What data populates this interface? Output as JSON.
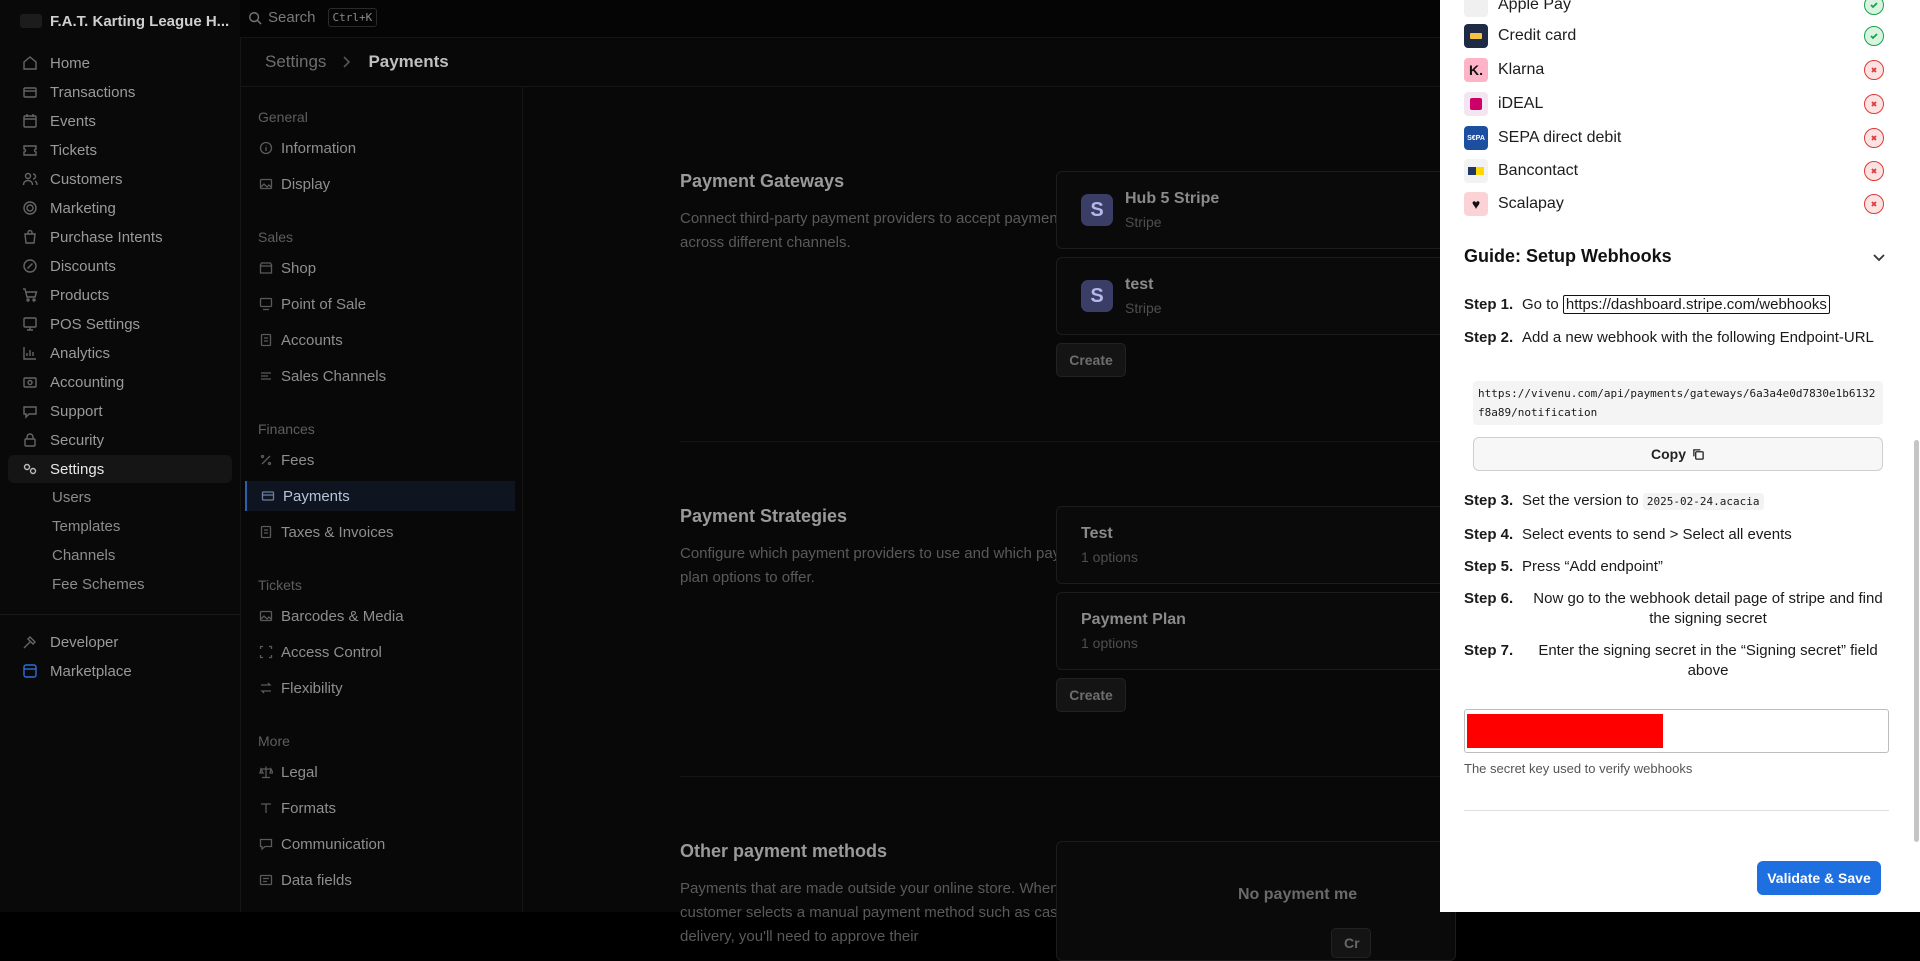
{
  "app": {
    "brand": "F.A.T. Karting League H...",
    "search_label": "Search",
    "search_shortcut": "Ctrl+K"
  },
  "nav": {
    "items": [
      {
        "label": "Home",
        "icon": "home-icon"
      },
      {
        "label": "Transactions",
        "icon": "transactions-icon"
      },
      {
        "label": "Events",
        "icon": "calendar-icon"
      },
      {
        "label": "Tickets",
        "icon": "ticket-icon"
      },
      {
        "label": "Customers",
        "icon": "users-icon"
      },
      {
        "label": "Marketing",
        "icon": "target-icon"
      },
      {
        "label": "Purchase Intents",
        "icon": "bag-icon"
      },
      {
        "label": "Discounts",
        "icon": "discount-icon"
      },
      {
        "label": "Products",
        "icon": "cart-icon"
      },
      {
        "label": "POS Settings",
        "icon": "pos-icon"
      },
      {
        "label": "Analytics",
        "icon": "chart-icon"
      },
      {
        "label": "Accounting",
        "icon": "accounting-icon"
      },
      {
        "label": "Support",
        "icon": "support-icon"
      },
      {
        "label": "Security",
        "icon": "lock-icon"
      },
      {
        "label": "Settings",
        "icon": "settings-icon"
      }
    ],
    "settings_sub": [
      "Users",
      "Templates",
      "Channels",
      "Fee Schemes"
    ],
    "developer": "Developer",
    "marketplace": "Marketplace"
  },
  "breadcrumb": {
    "parent": "Settings",
    "current": "Payments"
  },
  "subnav": {
    "general": "General",
    "information": "Information",
    "display": "Display",
    "sales": "Sales",
    "shop": "Shop",
    "pos": "Point of Sale",
    "accounts": "Accounts",
    "sales_channels": "Sales Channels",
    "finances": "Finances",
    "fees": "Fees",
    "payments": "Payments",
    "taxes": "Taxes & Invoices",
    "tickets": "Tickets",
    "barcodes": "Barcodes & Media",
    "access": "Access Control",
    "flexibility": "Flexibility",
    "more": "More",
    "legal": "Legal",
    "formats": "Formats",
    "communication": "Communication",
    "data_fields": "Data fields"
  },
  "gateways": {
    "title": "Payment Gateways",
    "desc": "Connect third-party payment providers to accept payments across different channels.",
    "items": [
      {
        "badge": "S",
        "name": "Hub 5 Stripe",
        "provider": "Stripe"
      },
      {
        "badge": "S",
        "name": "test",
        "provider": "Stripe"
      }
    ],
    "create": "Create"
  },
  "strategies": {
    "title": "Payment Strategies",
    "desc": "Configure which payment providers to use and which payment plan options to offer.",
    "items": [
      {
        "name": "Test",
        "sub": "1 options"
      },
      {
        "name": "Payment Plan",
        "sub": "1 options"
      }
    ],
    "create": "Create"
  },
  "other": {
    "title": "Other payment methods",
    "desc": "Payments that are made outside your online store. When a customer selects a manual payment method such as cash on delivery, you'll need to approve their",
    "empty": "No payment me",
    "create_partial": "Cr"
  },
  "drawer": {
    "methods": [
      {
        "name": "Apple Pay",
        "status": "enabled",
        "logo_bg": "#f0f0f0",
        "logo_color": "#111",
        "logo_text": ""
      },
      {
        "name": "Credit card",
        "status": "enabled",
        "logo_bg": "#1f2a44",
        "logo_color": "#f5c242",
        "logo_text": ""
      },
      {
        "name": "Klarna",
        "status": "disabled",
        "logo_bg": "#ffb3c7",
        "logo_color": "#111",
        "logo_text": "K."
      },
      {
        "name": "iDEAL",
        "status": "disabled",
        "logo_bg": "#f3e6f1",
        "logo_color": "#cc0066",
        "logo_text": ""
      },
      {
        "name": "SEPA direct debit",
        "status": "disabled",
        "logo_bg": "#1d4fa0",
        "logo_color": "#fff",
        "logo_text": "S€PA"
      },
      {
        "name": "Bancontact",
        "status": "disabled",
        "logo_bg": "#f2f2f2",
        "logo_color": "#1e3764",
        "logo_text": ""
      },
      {
        "name": "Scalapay",
        "status": "disabled",
        "logo_bg": "#fbd3d7",
        "logo_color": "#111",
        "logo_text": ""
      }
    ],
    "guide_title": "Guide: Setup Webhooks",
    "steps": {
      "s1_label": "Step 1.",
      "s1_pre": "Go to",
      "s1_link": "https://dashboard.stripe.com/webhooks",
      "s2_label": "Step 2.",
      "s2_text": "Add a new webhook with the following Endpoint-URL",
      "endpoint": "https://vivenu.com/api/payments/gateways/6a3a4e0d7830e1b6132f8a89/notification",
      "copy": "Copy",
      "s3_label": "Step 3.",
      "s3_pre": "Set the version to",
      "s3_version": "2025-02-24.acacia",
      "s4_label": "Step 4.",
      "s4_text": "Select events to send > Select all events",
      "s5_label": "Step 5.",
      "s5_text": "Press “Add endpoint”",
      "s6_label": "Step 6.",
      "s6_text": "Now go to the webhook detail page of stripe and find the signing secret",
      "s7_label": "Step 7.",
      "s7_text": "Enter the signing secret in the “Signing secret” field above"
    },
    "secret_hint": "The secret key used to verify webhooks",
    "save": "Validate & Save"
  }
}
